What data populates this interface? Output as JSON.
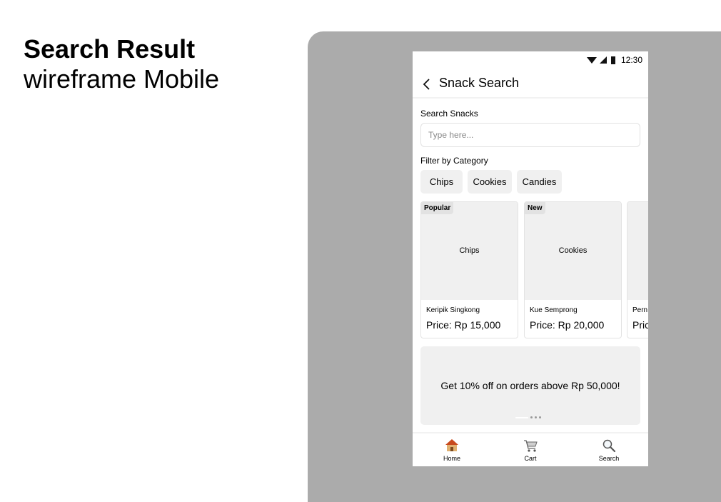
{
  "header": {
    "title": "Search Result",
    "subtitle": "wireframe Mobile"
  },
  "status_bar": {
    "time": "12:30",
    "icons": [
      "wifi-icon",
      "signal-icon",
      "battery-icon"
    ]
  },
  "app_bar": {
    "back_icon": "chevron-left-icon",
    "title": "Snack Search"
  },
  "search": {
    "label": "Search Snacks",
    "placeholder": "Type here...",
    "value": ""
  },
  "filter": {
    "label": "Filter by Category",
    "categories": [
      "Chips",
      "Cookies",
      "Candies"
    ]
  },
  "products": [
    {
      "badge": "Popular",
      "image_label": "Chips",
      "name": "Keripik Singkong",
      "price": "Price: Rp 15,000"
    },
    {
      "badge": "New",
      "image_label": "Cookies",
      "name": "Kue Semprong",
      "price": "Price: Rp 20,000"
    },
    {
      "badge": "",
      "image_label": "",
      "name": "Pern",
      "price": "Pric"
    }
  ],
  "promo": {
    "text": "Get 10% off on orders above Rp 50,000!",
    "carousel_pages": 4,
    "active_page": 1
  },
  "bottom_nav": [
    {
      "label": "Home",
      "icon": "house-icon"
    },
    {
      "label": "Cart",
      "icon": "cart-icon"
    },
    {
      "label": "Search",
      "icon": "magnifier-icon"
    }
  ],
  "colors": {
    "stage_background": "#ababab",
    "placeholder_fill": "#f0f0f0",
    "border": "#e3e3e3",
    "house_roof": "#c84a1e",
    "house_wall": "#e0b070"
  }
}
